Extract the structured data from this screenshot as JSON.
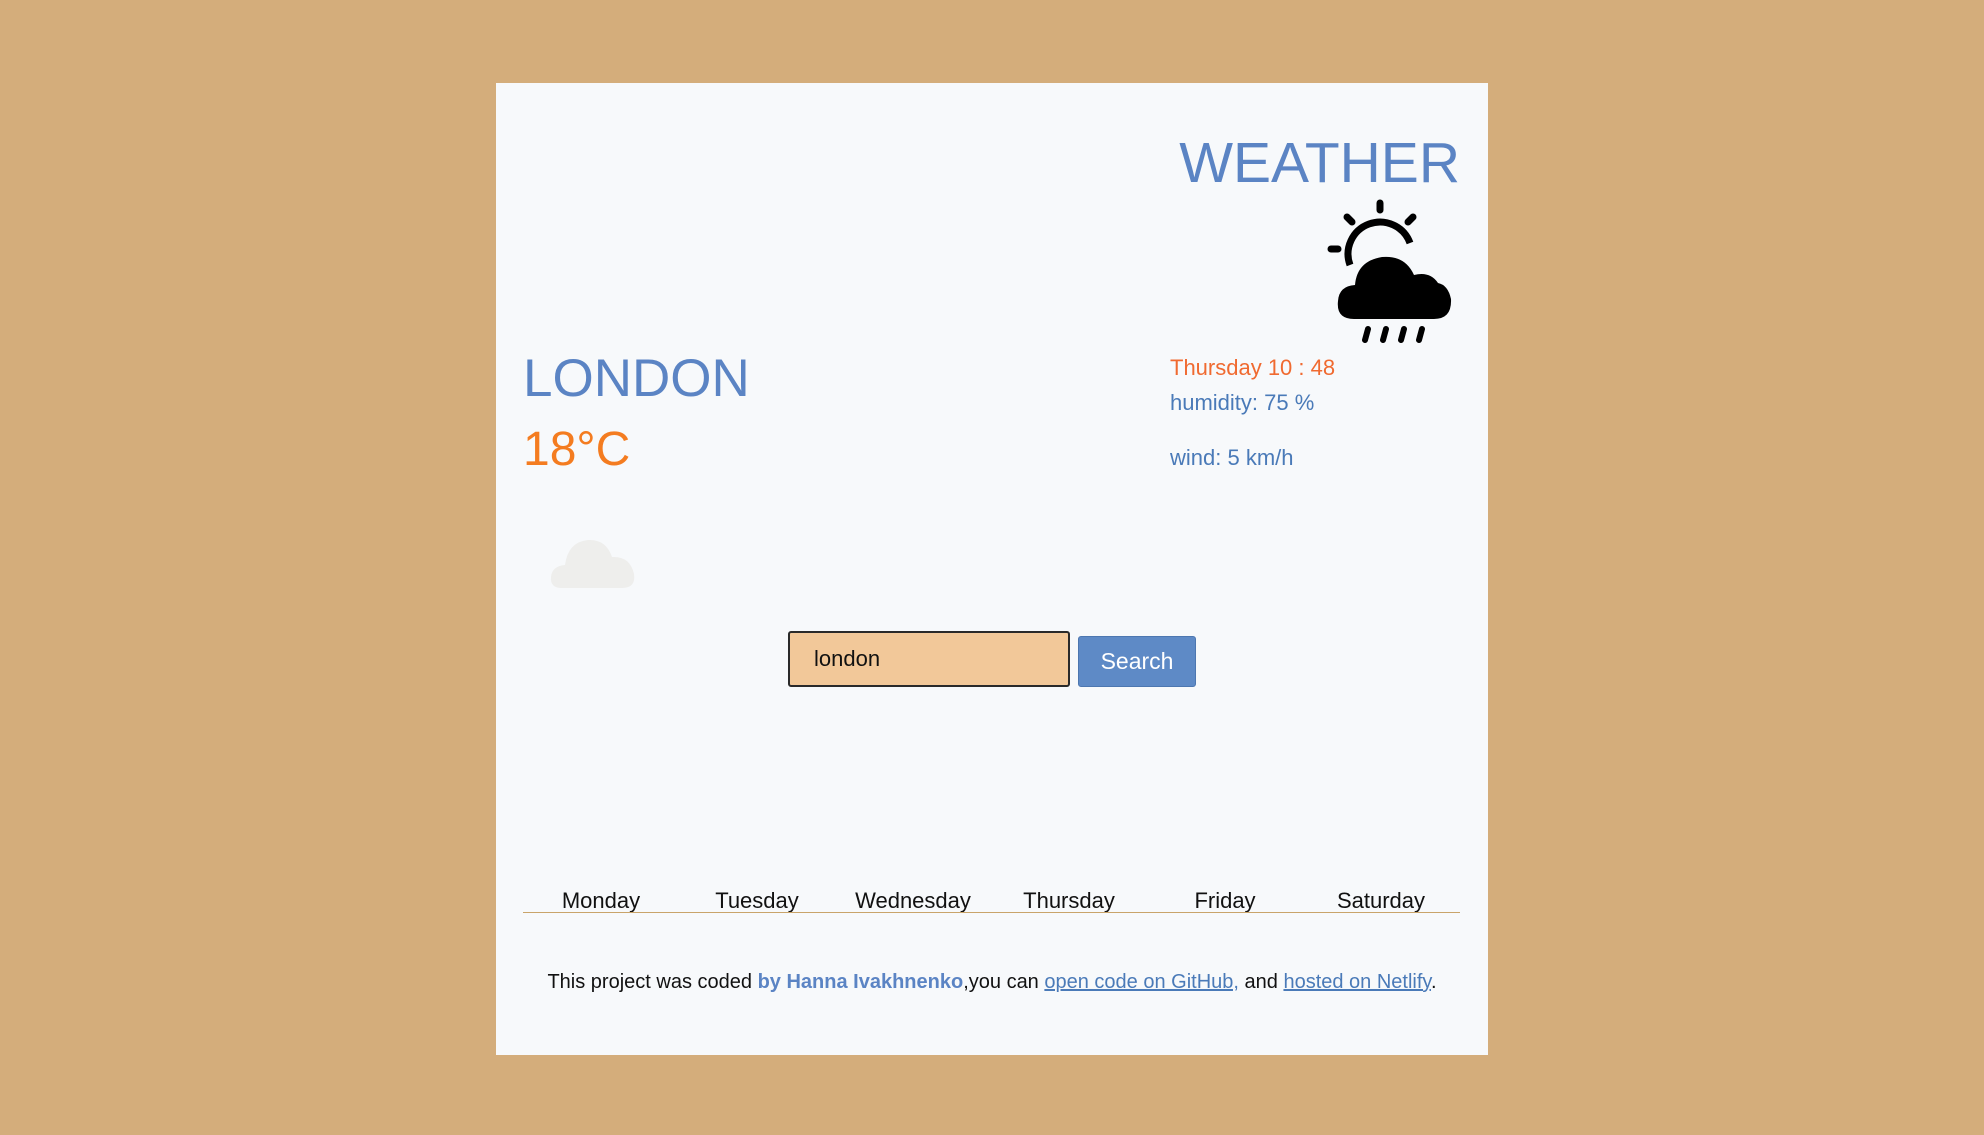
{
  "header": {
    "title": "WEATHER"
  },
  "current": {
    "city": "LONDON",
    "temperature": "18°C",
    "datetime": "Thursday 10 : 48",
    "humidity": "humidity: 75 %",
    "wind": "wind: 5 km/h",
    "icon": "sun-behind-rain-cloud-icon",
    "secondary_icon": "cloud-icon"
  },
  "search": {
    "value": "london",
    "button_label": "Search"
  },
  "forecast": {
    "days": [
      "Monday",
      "Tuesday",
      "Wednesday",
      "Thursday",
      "Friday",
      "Saturday"
    ]
  },
  "footer": {
    "text_before": "This project was coded ",
    "author": "by Hanna Ivakhnenko",
    "text_middle": ",you can ",
    "github_link": "open code on GitHub,",
    "text_and": " and ",
    "netlify_link": "hosted on Netlify",
    "text_end": "."
  },
  "colors": {
    "background": "#d4ad7b",
    "card": "#f7f9fb",
    "accent_blue": "#5b84c4",
    "accent_orange": "#f47c20",
    "input_fill": "#f2c899",
    "divider": "#c9a46a"
  }
}
